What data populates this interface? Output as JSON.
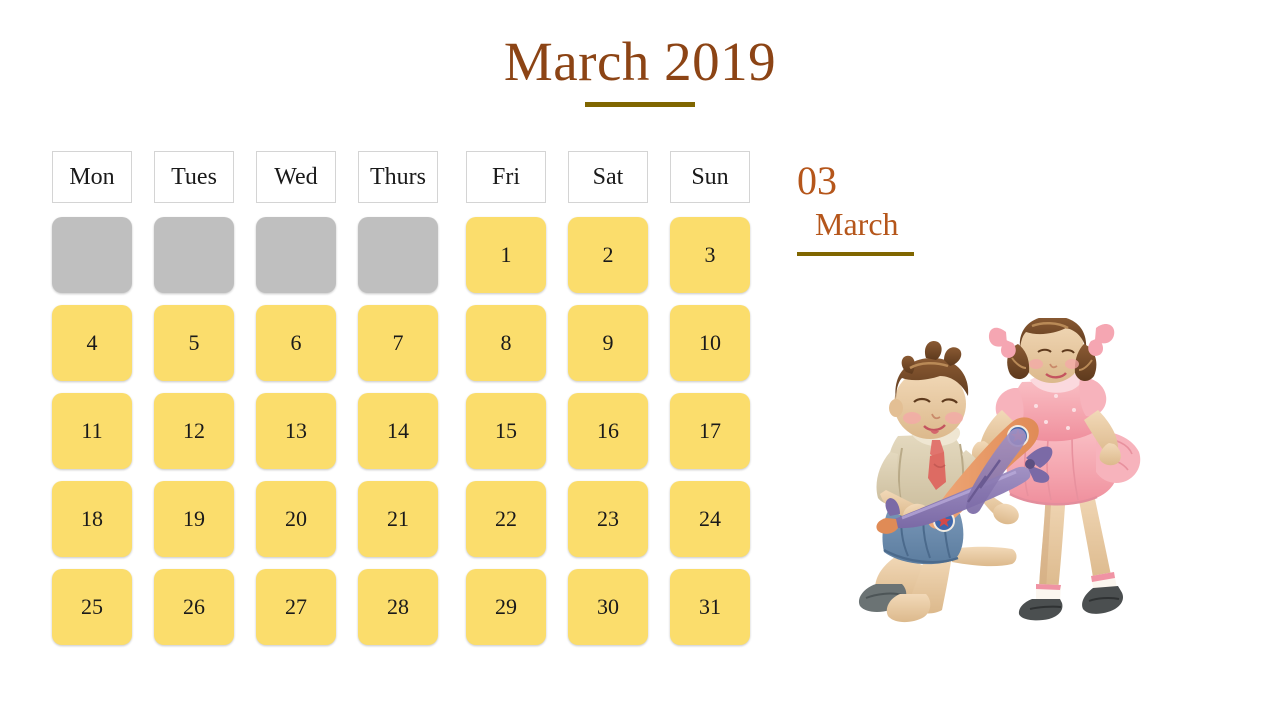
{
  "header": {
    "title": "March 2019"
  },
  "side_panel": {
    "day_number": "03",
    "month_name": "March"
  },
  "calendar": {
    "weekday_headers": [
      "Mon",
      "Tues",
      "Wed",
      "Thurs",
      "Fri",
      "Sat",
      "Sun"
    ],
    "weeks": [
      [
        {
          "label": "",
          "state": "empty"
        },
        {
          "label": "",
          "state": "empty"
        },
        {
          "label": "",
          "state": "empty"
        },
        {
          "label": "",
          "state": "empty"
        },
        {
          "label": "1",
          "state": "filled"
        },
        {
          "label": "2",
          "state": "filled"
        },
        {
          "label": "3",
          "state": "filled"
        }
      ],
      [
        {
          "label": "4",
          "state": "filled"
        },
        {
          "label": "5",
          "state": "filled"
        },
        {
          "label": "6",
          "state": "filled"
        },
        {
          "label": "7",
          "state": "filled"
        },
        {
          "label": "8",
          "state": "filled"
        },
        {
          "label": "9",
          "state": "filled"
        },
        {
          "label": "10",
          "state": "filled"
        }
      ],
      [
        {
          "label": "11",
          "state": "filled"
        },
        {
          "label": "12",
          "state": "filled"
        },
        {
          "label": "13",
          "state": "filled"
        },
        {
          "label": "14",
          "state": "filled"
        },
        {
          "label": "15",
          "state": "filled"
        },
        {
          "label": "16",
          "state": "filled"
        },
        {
          "label": "17",
          "state": "filled"
        }
      ],
      [
        {
          "label": "18",
          "state": "filled"
        },
        {
          "label": "19",
          "state": "filled"
        },
        {
          "label": "20",
          "state": "filled"
        },
        {
          "label": "21",
          "state": "filled"
        },
        {
          "label": "22",
          "state": "filled"
        },
        {
          "label": "23",
          "state": "filled"
        },
        {
          "label": "24",
          "state": "filled"
        }
      ],
      [
        {
          "label": "25",
          "state": "filled"
        },
        {
          "label": "26",
          "state": "filled"
        },
        {
          "label": "27",
          "state": "filled"
        },
        {
          "label": "28",
          "state": "filled"
        },
        {
          "label": "29",
          "state": "filled"
        },
        {
          "label": "30",
          "state": "filled"
        },
        {
          "label": "31",
          "state": "filled"
        }
      ]
    ]
  },
  "illustration": {
    "name": "two-children-playing-with-toy-airplane-illustration",
    "description": "Vintage watercolor of a boy kneeling holding a toy biplane and a girl in a pink dress bending over to look"
  },
  "colors": {
    "title_brown": "#8c4415",
    "rule_olive": "#806600",
    "accent_rust": "#b5561b",
    "date_yellow": "#fbdd6c",
    "empty_gray": "#bfbfbf",
    "page_background": "#ffffff",
    "text_dark": "#1a1a1a"
  }
}
